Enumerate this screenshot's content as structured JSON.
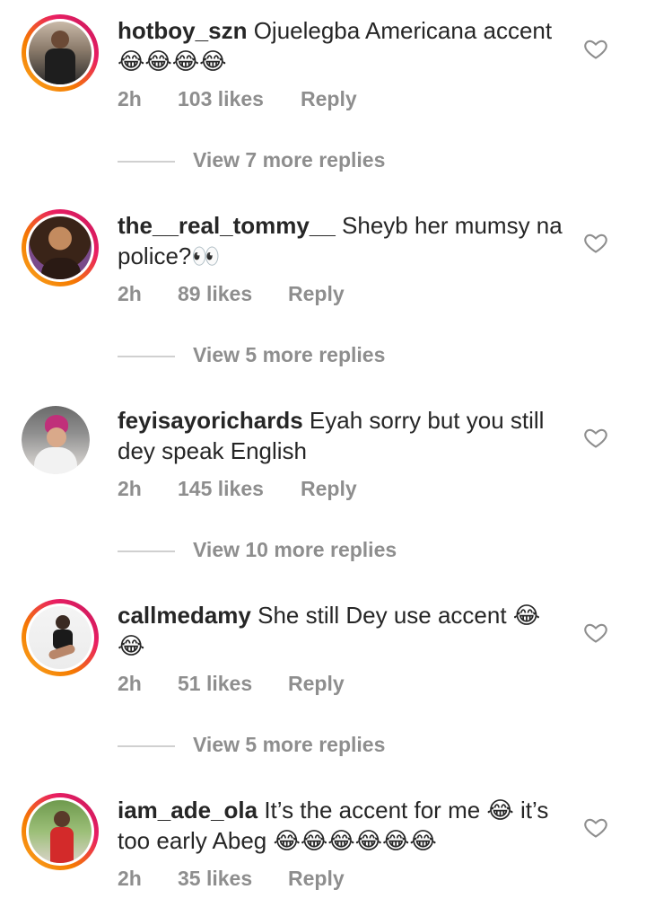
{
  "comments": [
    {
      "username": "hotboy_szn",
      "text": "Ojuelegba Americana accent 😂😂😂😂",
      "time": "2h",
      "likes": "103 likes",
      "reply": "Reply",
      "view_replies": "View 7 more replies"
    },
    {
      "username": "the__real_tommy__",
      "text": "Sheyb her mumsy na police?👀",
      "time": "2h",
      "likes": "89 likes",
      "reply": "Reply",
      "view_replies": "View 5 more replies"
    },
    {
      "username": "feyisayorichards",
      "text": "Eyah sorry but you still dey speak English",
      "time": "2h",
      "likes": "145 likes",
      "reply": "Reply",
      "view_replies": "View 10 more replies"
    },
    {
      "username": "callmedamy",
      "text": "She still Dey use accent 😂😂",
      "time": "2h",
      "likes": "51 likes",
      "reply": "Reply",
      "view_replies": "View 5 more replies"
    },
    {
      "username": "iam_ade_ola",
      "text": "It’s the accent for me 😂 it’s too early Abeg 😂😂😂😂😂😂",
      "time": "2h",
      "likes": "35 likes",
      "reply": "Reply"
    }
  ],
  "icons": {
    "like": "heart-outline-icon"
  },
  "colors": {
    "secondary_text": "#8e8e8e",
    "primary_text": "#262626"
  }
}
